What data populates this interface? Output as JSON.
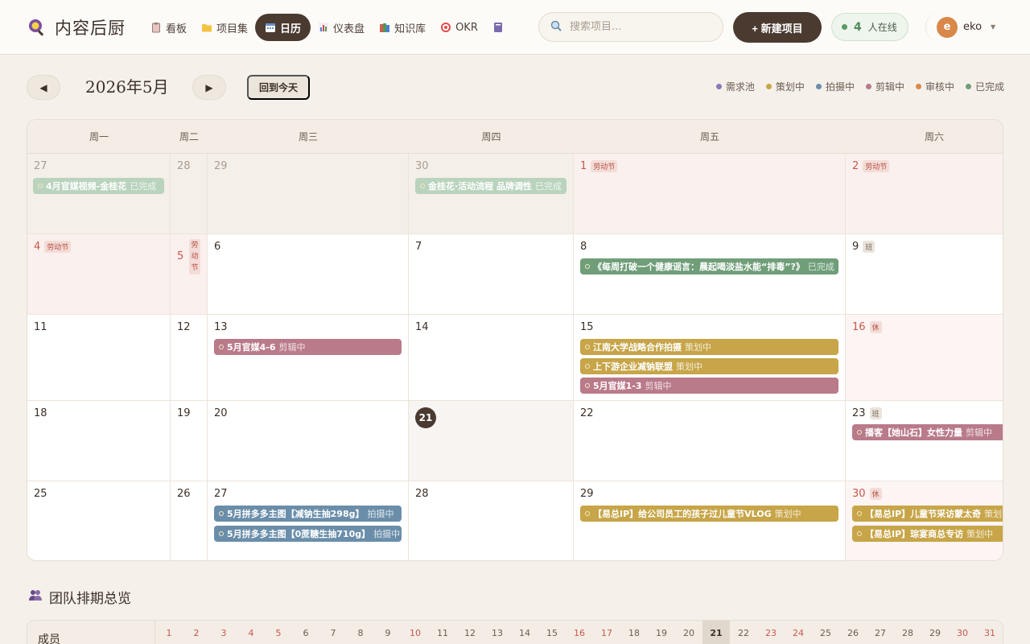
{
  "app": {
    "name": "内容后厨"
  },
  "nav": [
    {
      "label": "看板",
      "icon": "clipboard-icon",
      "active": false
    },
    {
      "label": "项目集",
      "icon": "folder-icon",
      "active": false
    },
    {
      "label": "日历",
      "icon": "calendar-icon",
      "active": true
    },
    {
      "label": "仪表盘",
      "icon": "bar-chart-icon",
      "active": false
    },
    {
      "label": "知识库",
      "icon": "books-icon",
      "active": false
    },
    {
      "label": "OKR",
      "icon": "target-icon",
      "active": false
    }
  ],
  "search": {
    "placeholder": "搜索项目..."
  },
  "new_project": {
    "label": "+ 新建项目"
  },
  "online": {
    "count": "4",
    "label": "人在线"
  },
  "user": {
    "initial": "e",
    "name": "eko"
  },
  "calendar": {
    "title": "2026年5月",
    "prev_label": "◀",
    "next_label": "▶",
    "today_label": "回到今天",
    "legend": [
      {
        "label": "需求池",
        "color": "#8a7ab8"
      },
      {
        "label": "策划中",
        "color": "#c7a548"
      },
      {
        "label": "拍摄中",
        "color": "#6a8eaa"
      },
      {
        "label": "剪辑中",
        "color": "#b97a8a"
      },
      {
        "label": "审核中",
        "color": "#d98a4a"
      },
      {
        "label": "已完成",
        "color": "#6f9e79"
      }
    ],
    "weekdays": [
      "周一",
      "周二",
      "周三",
      "周四",
      "周五",
      "周六"
    ],
    "tags": {
      "labor_day": "劳动节",
      "work": "班",
      "rest": "休",
      "labor_day_vertical": "劳\n动\n节"
    },
    "days": {
      "d27a": "27",
      "d28a": "28",
      "d29a": "29",
      "d30a": "30",
      "d1": "1",
      "d2": "2",
      "d4": "4",
      "d5": "5",
      "d6": "6",
      "d7": "7",
      "d8": "8",
      "d9": "9",
      "d11": "11",
      "d12": "12",
      "d13": "13",
      "d14": "14",
      "d15": "15",
      "d16": "16",
      "d18": "18",
      "d19": "19",
      "d20": "20",
      "d21": "21",
      "d22": "22",
      "d23": "23",
      "d25": "25",
      "d26": "26",
      "d27": "27",
      "d28": "28",
      "d29": "29",
      "d30": "30"
    },
    "events": [
      {
        "title": "4月官媒视频-金桂花",
        "status": "已完成"
      },
      {
        "title": "金桂花·活动流程 品牌调性",
        "status": "已完成"
      },
      {
        "title": "《每周打破一个健康谣言：晨起喝淡盐水能“排毒”?》",
        "status": "已完成"
      },
      {
        "title": "5月官媒4-6",
        "status": "剪辑中"
      },
      {
        "title": "江南大学战略合作拍摄",
        "status": "策划中"
      },
      {
        "title": "上下游企业减钠联盟",
        "status": "策划中"
      },
      {
        "title": "5月官媒1-3",
        "status": "剪辑中"
      },
      {
        "title": "播客【她山石】女性力量",
        "status": "剪辑中"
      },
      {
        "title": "5月拼多多主图【减钠生抽298g】",
        "status": "拍摄中"
      },
      {
        "title": "5月拼多多主图【0蔗糖生抽710g】",
        "status": "拍摄中"
      },
      {
        "title": "【易总IP】给公司员工的孩子过儿童节VLOG",
        "status": "策划中"
      },
      {
        "title": "【易总IP】儿童节采访蒙太奇",
        "status": "策划中"
      },
      {
        "title": "【易总IP】琮宴商总专访",
        "status": "策划中"
      }
    ]
  },
  "team": {
    "title": "团队排期总览",
    "member_label": "成员",
    "days": [
      "1",
      "2",
      "3",
      "4",
      "5",
      "6",
      "7",
      "8",
      "9",
      "10",
      "11",
      "12",
      "13",
      "14",
      "15",
      "16",
      "17",
      "18",
      "19",
      "20",
      "21",
      "22",
      "23",
      "24",
      "25",
      "26",
      "27",
      "28",
      "29",
      "30",
      "31"
    ]
  }
}
